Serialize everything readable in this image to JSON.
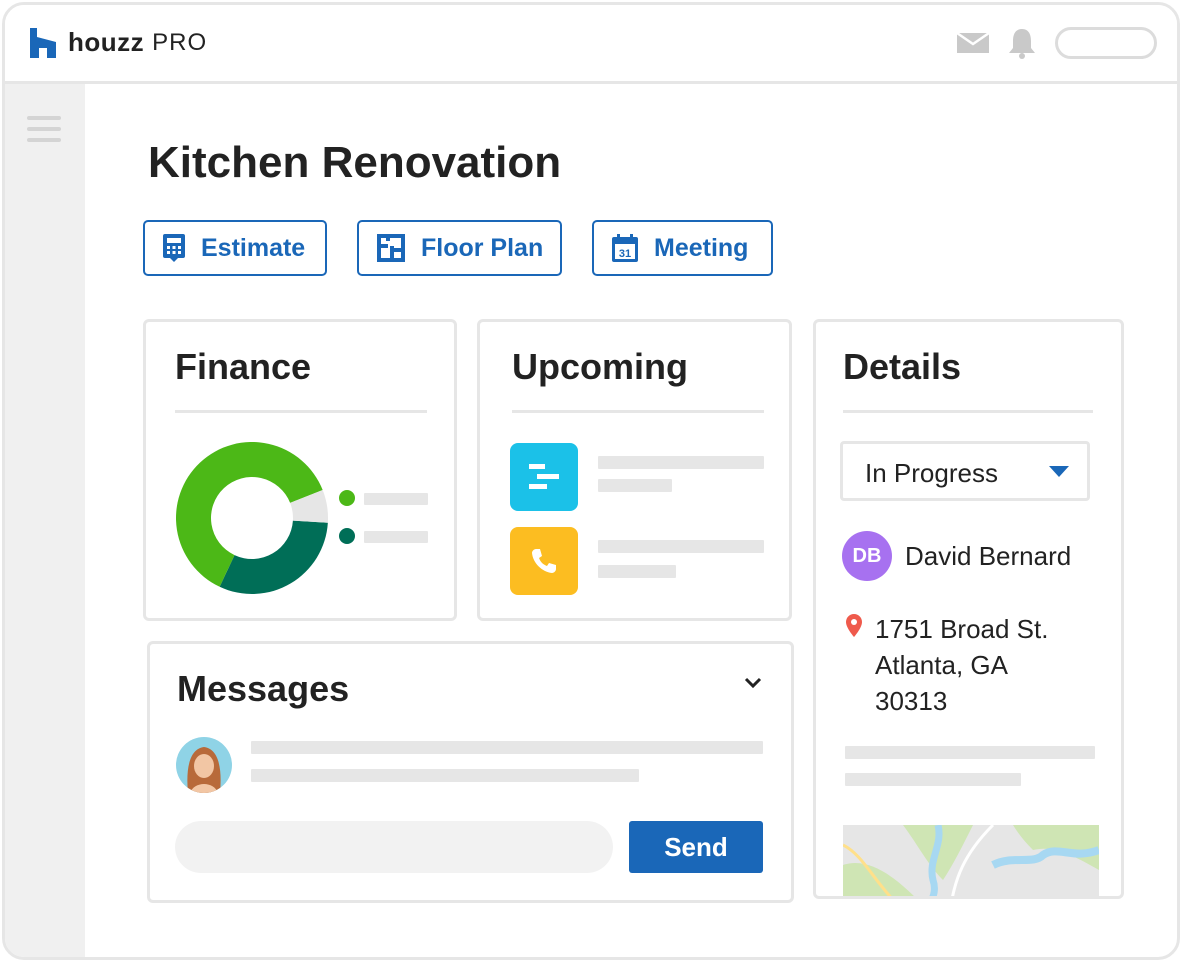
{
  "brand": {
    "name": "houzz",
    "suffix": "PRO",
    "accent": "#1a67b8"
  },
  "header": {
    "icons": [
      "mail-icon",
      "bell-icon"
    ]
  },
  "page": {
    "title": "Kitchen Renovation"
  },
  "actions": [
    {
      "label": "Estimate",
      "icon": "calculator-icon"
    },
    {
      "label": "Floor Plan",
      "icon": "floor-plan-icon"
    },
    {
      "label": "Meeting",
      "icon": "calendar-icon",
      "icon_text": "31"
    }
  ],
  "finance": {
    "title": "Finance",
    "chart_data": {
      "type": "pie",
      "donut": true,
      "segments": [
        {
          "share": 0.62,
          "color": "#4cb817"
        },
        {
          "share": 0.31,
          "color": "#006e57"
        },
        {
          "share": 0.07,
          "color": "#e6e6e6"
        }
      ]
    }
  },
  "upcoming": {
    "title": "Upcoming",
    "items": [
      {
        "icon": "timeline-icon",
        "color": "#1bc1e8"
      },
      {
        "icon": "phone-icon",
        "color": "#fcbd21"
      }
    ]
  },
  "details": {
    "title": "Details",
    "status": "In Progress",
    "contact": {
      "initials": "DB",
      "name": "David Bernard"
    },
    "address": {
      "line1": "1751 Broad St.",
      "line2": "Atlanta, GA",
      "line3": "30313"
    }
  },
  "messages": {
    "title": "Messages",
    "send_label": "Send"
  }
}
